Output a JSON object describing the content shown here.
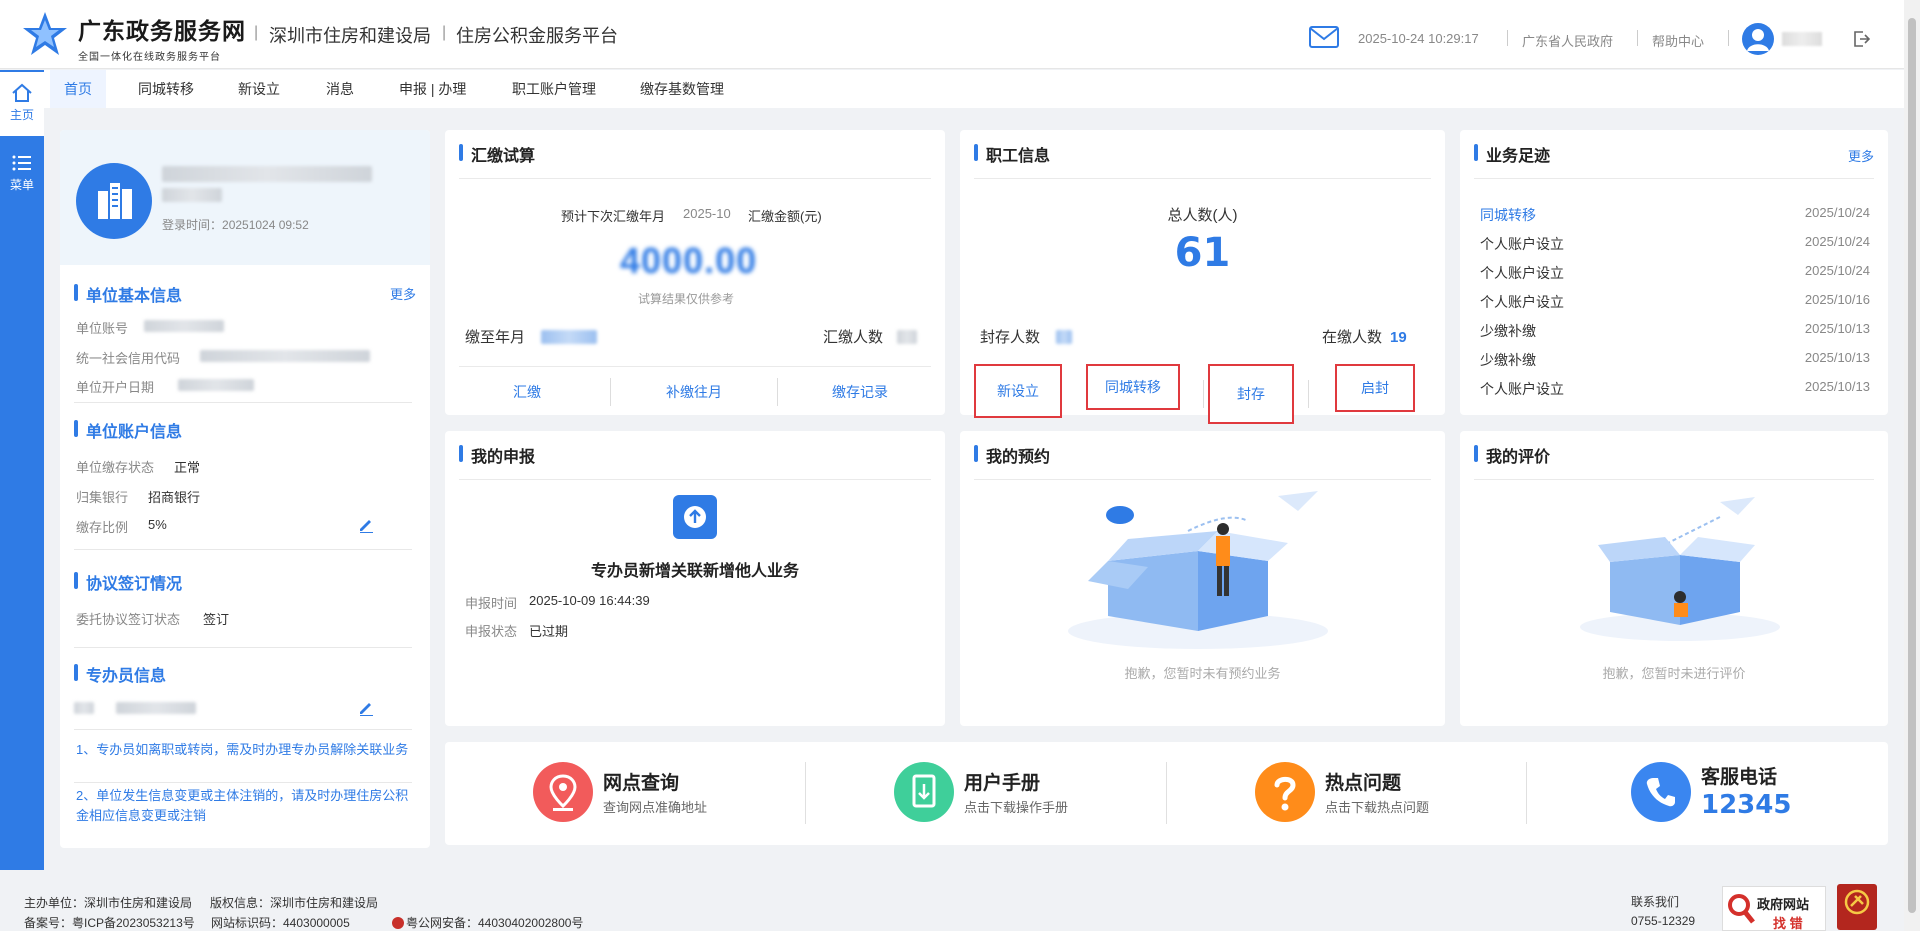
{
  "header": {
    "brand_title": "广东政务服务网",
    "brand_sub": "全国一体化在线政务服务平台",
    "sep": "|",
    "agency": "深圳市住房和建设局",
    "platform": "住房公积金服务平台",
    "datetime": "2025-10-24 10:29:17",
    "gov_link": "广东省人民政府",
    "help_link": "帮助中心"
  },
  "rail": [
    {
      "label": "主页",
      "icon": "home-icon"
    },
    {
      "label": "菜单",
      "icon": "menu-icon"
    }
  ],
  "nav": [
    "首页",
    "同城转移",
    "新设立",
    "消息",
    "申报 | 办理",
    "职工账户管理",
    "缴存基数管理"
  ],
  "profile": {
    "login_label": "登录时间：",
    "login_time": "20251024 09:52"
  },
  "unit_basic": {
    "title": "单位基本信息",
    "more": "更多",
    "labels": [
      "单位账号",
      "统一社会信用代码",
      "单位开户日期"
    ]
  },
  "unit_account": {
    "title": "单位账户信息",
    "rows": [
      {
        "label": "单位缴存状态",
        "value": "正常"
      },
      {
        "label": "归集银行",
        "value": "招商银行"
      },
      {
        "label": "缴存比例",
        "value": "5%"
      }
    ]
  },
  "agreement": {
    "title": "协议签订情况",
    "label": "委托协议签订状态",
    "value": "签订"
  },
  "agent": {
    "title": "专办员信息",
    "notice1": "1、专办员如离职或转岗，需及时办理专办员解除关联业务",
    "notice2": "2、单位发生信息变更或主体注销的，请及时办理住房公积金相应信息变更或注销"
  },
  "calc": {
    "title": "汇缴试算",
    "next_label": "预计下次汇缴年月",
    "next_value": "2025-10",
    "amount_label": "汇缴金额(元)",
    "amount": "4000.00",
    "note": "试算结果仅供参考",
    "paid_until_label": "缴至年月",
    "count_label": "汇缴人数",
    "links": [
      "汇缴",
      "补缴往月",
      "缴存记录"
    ]
  },
  "staff": {
    "title": "职工信息",
    "total_label": "总人数(人)",
    "total": "61",
    "sealed_label": "封存人数",
    "active_label": "在缴人数",
    "active": "19",
    "buttons": [
      "新设立",
      "同城转移",
      "封存",
      "启封"
    ]
  },
  "trail": {
    "title": "业务足迹",
    "more": "更多",
    "rows": [
      {
        "name": "同城转移",
        "date": "2025/10/24"
      },
      {
        "name": "个人账户设立",
        "date": "2025/10/24"
      },
      {
        "name": "个人账户设立",
        "date": "2025/10/24"
      },
      {
        "name": "个人账户设立",
        "date": "2025/10/16"
      },
      {
        "name": "少缴补缴",
        "date": "2025/10/13"
      },
      {
        "name": "少缴补缴",
        "date": "2025/10/13"
      },
      {
        "name": "个人账户设立",
        "date": "2025/10/13"
      }
    ]
  },
  "report": {
    "title": "我的申报",
    "item_title": "专办员新增关联新增他人业务",
    "time_label": "申报时间",
    "time": "2025-10-09 16:44:39",
    "status_label": "申报状态",
    "status": "已过期"
  },
  "appointment": {
    "title": "我的预约",
    "empty": "抱歉，您暂时未有预约业务"
  },
  "evaluation": {
    "title": "我的评价",
    "empty": "抱歉，您暂时未进行评价"
  },
  "strip": [
    {
      "title": "网点查询",
      "sub": "查询网点准确地址",
      "color": "#f25b5b",
      "icon": "location-icon"
    },
    {
      "title": "用户手册",
      "sub": "点击下载操作手册",
      "color": "#3fcf9a",
      "icon": "manual-icon"
    },
    {
      "title": "热点问题",
      "sub": "点击下载热点问题",
      "color": "#ff8c1a",
      "icon": "question-icon"
    },
    {
      "title": "客服电话",
      "phone": "12345",
      "color": "#3a86f0",
      "icon": "phone-icon"
    }
  ],
  "footer": {
    "host": "主办单位：深圳市住房和建设局",
    "copyright": "版权信息：深圳市住房和建设局",
    "icp": "备案号：粤ICP备2023053213号",
    "site_id": "网站标识码：4403000005",
    "police": "粤公网安备：44030402002800号",
    "contact_label": "联系我们",
    "contact_phone": "0755-12329",
    "badge_top": "政府网站",
    "badge_bottom": "找 错"
  },
  "colors": {
    "primary": "#2f7be5",
    "alert": "#e0393e"
  }
}
